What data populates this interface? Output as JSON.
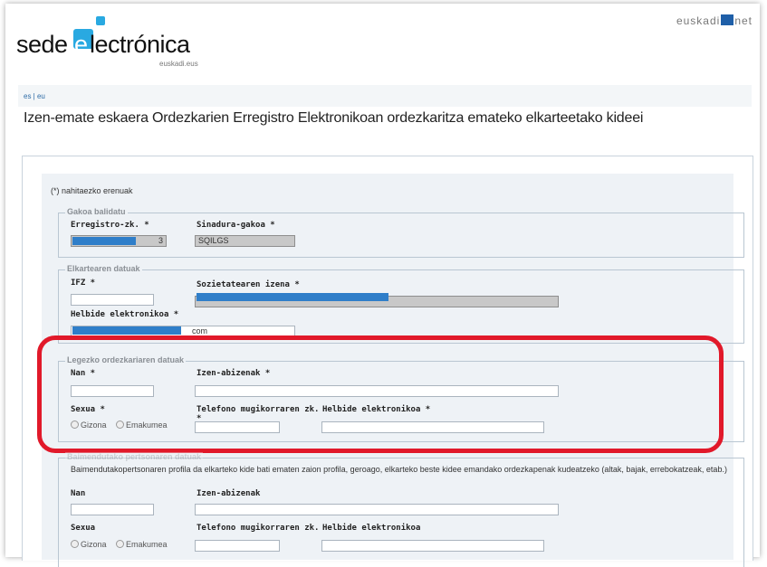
{
  "header": {
    "logo_sede": "sede",
    "logo_e": "e",
    "logo_rest": "lectrónica",
    "logo_sub": "euskadi.eus",
    "euskadi_left": "euskadi",
    "euskadi_right": "net",
    "lang_links": "es | eu"
  },
  "page_title": "Izen-emate eskaera Ordezkarien Erregistro Elektronikoan ordezkaritza emateko elkarteetako kideei",
  "form": {
    "required_note": "(*) nahitaezko erenuak",
    "gakoa": {
      "legend": "Gakoa balidatu",
      "erregistro_label": "Erregistro-zk. *",
      "erregistro_value": "3",
      "sinadura_label": "Sinadura-gakoa *",
      "sinadura_value": "SQILGS"
    },
    "elkartea": {
      "legend": "Elkartearen datuak",
      "ifz_label": "IFZ *",
      "ifz_value": "",
      "sozietate_label": "Sozietatearen izena *",
      "helbide_label": "Helbide elektronikoa *",
      "helbide_value": "com"
    },
    "legezko": {
      "legend": "Legezko ordezkariaren datuak",
      "nan_label": "Nan *",
      "izen_label": "Izen-abizenak *",
      "sexua_label": "Sexua *",
      "gizona": "Gizona",
      "emakumea": "Emakumea",
      "telefono_label": "Telefono mugikorraren zk.",
      "telefono_star": "*",
      "helbide_label": "Helbide elektronikoa *"
    },
    "baimendutako": {
      "legend": "Baimendutako pertsonaren datuak",
      "description": "Baimendutakopertsonaren profila da elkarteko kide bati ematen zaion profila, geroago, elkarteko beste kidee emandako ordezkapenak kudeatzeko (altak, bajak, errebokatzeak, etab.)",
      "nan_label": "Nan",
      "izen_label": "Izen-abizenak",
      "sexua_label": "Sexua",
      "gizona": "Gizona",
      "emakumea": "Emakumea",
      "telefono_label": "Telefono mugikorraren zk.",
      "helbide_label": "Helbide elektronikoa"
    }
  },
  "colors": {
    "accent": "#29a9e1",
    "highlight": "#e1192a",
    "redaction": "#2f7ec9"
  }
}
